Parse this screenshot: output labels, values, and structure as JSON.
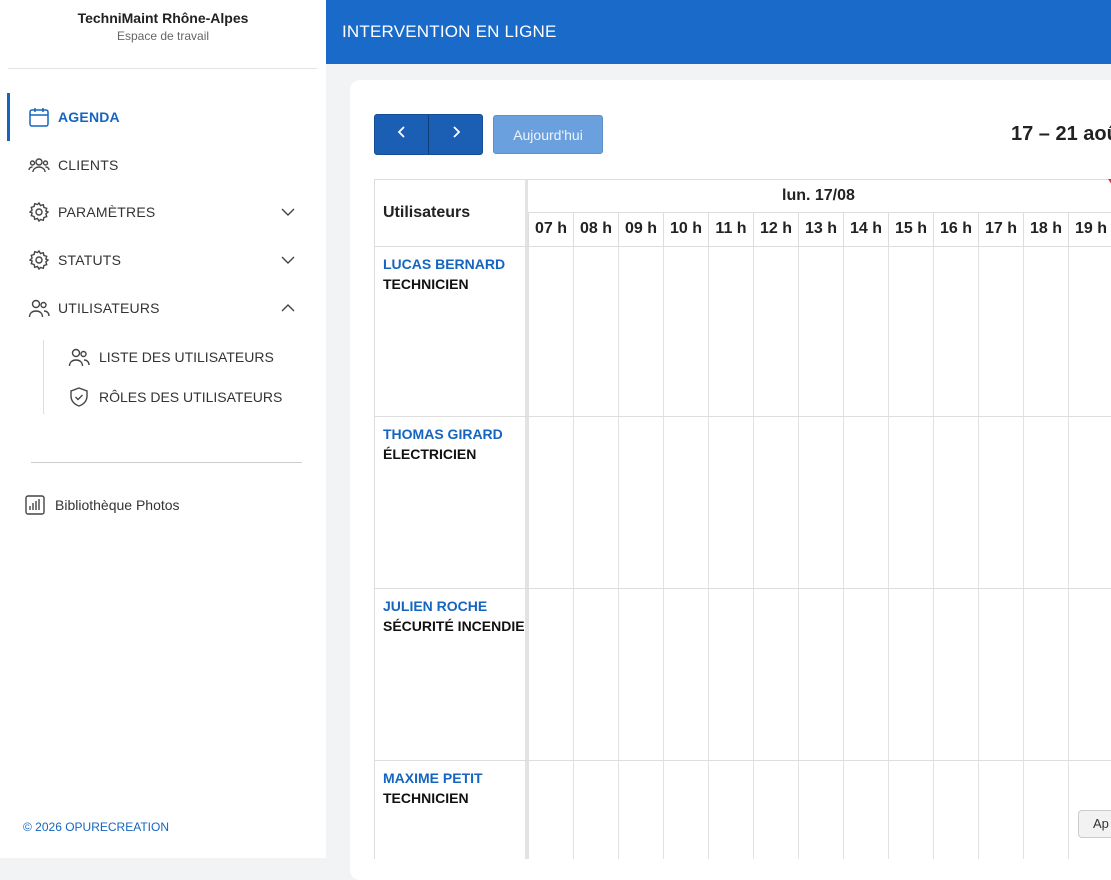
{
  "sidebar": {
    "org_name": "TechniMaint Rhône-Alpes",
    "org_subtitle": "Espace de travail",
    "nav": [
      {
        "label": "AGENDA",
        "icon": "calendar-icon"
      },
      {
        "label": "CLIENTS",
        "icon": "users-group-icon"
      },
      {
        "label": "PARAMÈTRES",
        "icon": "gear-icon"
      },
      {
        "label": "STATUTS",
        "icon": "gear-icon"
      },
      {
        "label": "UTILISATEURS",
        "icon": "users-icon"
      }
    ],
    "sub_items": [
      {
        "label": "LISTE DES UTILISATEURS",
        "icon": "users-icon"
      },
      {
        "label": "RÔLES DES UTILISATEURS",
        "icon": "shield-check-icon"
      }
    ],
    "photos_label": "Bibliothèque Photos",
    "copyright": "© 2026  OPURECREATION"
  },
  "header": {
    "title": "INTERVENTION EN LIGNE"
  },
  "toolbar": {
    "today_label": "Aujourd'hui",
    "date_range": "17 – 21 aoû"
  },
  "calendar": {
    "users_header": "Utilisateurs",
    "day_label": "lun. 17/08",
    "hours": [
      "07 h",
      "08 h",
      "09 h",
      "10 h",
      "11 h",
      "12 h",
      "13 h",
      "14 h",
      "15 h",
      "16 h",
      "17 h",
      "18 h",
      "19 h"
    ],
    "users": [
      {
        "name": "LUCAS BERNARD",
        "role": "TECHNICIEN"
      },
      {
        "name": "THOMAS GIRARD",
        "role": "ÉLECTRICIEN"
      },
      {
        "name": "JULIEN ROCHE",
        "role": "SÉCURITÉ INCENDIE"
      },
      {
        "name": "MAXIME PETIT",
        "role": "TECHNICIEN"
      }
    ]
  },
  "floating_button": {
    "label": "Ap"
  },
  "colors": {
    "accent": "#1a6bc9",
    "active_nav": "#1565c0"
  }
}
